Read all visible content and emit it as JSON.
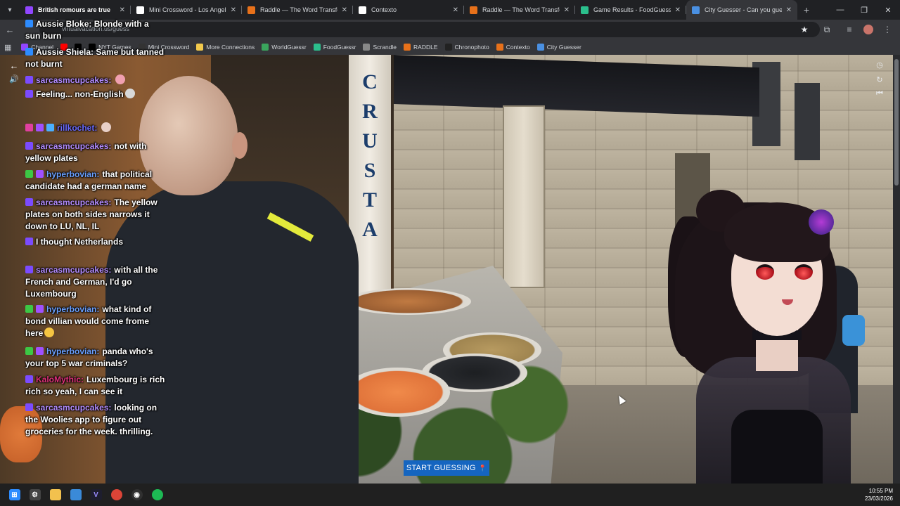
{
  "tabs": [
    {
      "title": "British romours are true",
      "favicon": "twitch-icon",
      "color": "#9146ff",
      "active": false
    },
    {
      "title": "Mini Crossword - Los Angeles T",
      "favicon": "la-times-icon",
      "color": "#ffffff",
      "active": false
    },
    {
      "title": "Raddle — The Word Transform",
      "favicon": "raddle-icon",
      "color": "#e8711a",
      "active": false
    },
    {
      "title": "Contexto",
      "favicon": "document-icon",
      "color": "#ffffff",
      "active": false
    },
    {
      "title": "Raddle — The Word Transform",
      "favicon": "raddle-icon",
      "color": "#e8711a",
      "active": false
    },
    {
      "title": "Game Results - FoodGuessr | F",
      "favicon": "foodguessr-icon",
      "color": "#2bbf8c",
      "active": false
    },
    {
      "title": "City Guesser - Can you gue",
      "favicon": "globe-icon",
      "color": "#4a90e2",
      "active": true
    }
  ],
  "omnibox": {
    "url": "virtualvacation.us/guess"
  },
  "bookmarks": [
    {
      "label": "Channel",
      "icon": "twitch-icon",
      "color": "#9146ff"
    },
    {
      "label": "",
      "icon": "youtube-icon",
      "color": "#ff0000"
    },
    {
      "label": "",
      "icon": "x-icon",
      "color": "#000000"
    },
    {
      "label": "NYT Games",
      "icon": "nyt-icon",
      "color": "#000000"
    },
    {
      "label": "Mini Crossword",
      "icon": "la-times-icon",
      "color": "#333333"
    },
    {
      "label": "More Connections",
      "icon": "grid-icon",
      "color": "#f2c94c"
    },
    {
      "label": "WorldGuessr",
      "icon": "globe-icon",
      "color": "#3aa55d"
    },
    {
      "label": "FoodGuessr",
      "icon": "foodguessr-icon",
      "color": "#2bbf8c"
    },
    {
      "label": "Scrandle",
      "icon": "scrandle-icon",
      "color": "#888888"
    },
    {
      "label": "RADDLE",
      "icon": "raddle-icon",
      "color": "#e8711a"
    },
    {
      "label": "Chronophoto",
      "icon": "camera-icon",
      "color": "#222222"
    },
    {
      "label": "Contexto",
      "icon": "document-icon",
      "color": "#e8711a"
    },
    {
      "label": "City Guesser",
      "icon": "globe-icon",
      "color": "#4a90e2"
    }
  ],
  "chat": [
    {
      "user": "",
      "user_color": "#e0307a",
      "text": "Aussie Bloke: Blonde with a sun burn",
      "badges": [
        "#2d8cff"
      ]
    },
    {
      "user": "",
      "user_color": "#e0307a",
      "text": "Aussie Shiela: Same but tanned not burnt",
      "badges": [
        "#2d8cff"
      ]
    },
    {
      "user": "sarcasmcupcakes:",
      "user_color": "#b38cff",
      "text": "",
      "badges": [
        "#7b4bff"
      ],
      "emote": "#f0a0b0"
    },
    {
      "user": "",
      "user_color": "#e0307a",
      "text": "Feeling... non-English",
      "badges": [
        "#7b4bff"
      ],
      "emote": "#d8d8d8"
    },
    {
      "user": "rillkochet:",
      "user_color": "#6b6bff",
      "text": "",
      "badges": [
        "#e040a0",
        "#a050ff",
        "#4ab0ff"
      ],
      "emote": "#e8d0c8"
    },
    {
      "user": "sarcasmcupcakes:",
      "user_color": "#b38cff",
      "text": "not with yellow plates",
      "badges": [
        "#7b4bff"
      ]
    },
    {
      "user": "hyperbovian:",
      "user_color": "#6aa0ff",
      "text": "that political candidate had a german name",
      "badges": [
        "#3cc845",
        "#a050ff"
      ]
    },
    {
      "user": "sarcasmcupcakes:",
      "user_color": "#b38cff",
      "text": "The yellow plates on both sides narrows it down to LU, NL, IL",
      "badges": [
        "#7b4bff"
      ]
    },
    {
      "user": "",
      "user_color": "#e0307a",
      "text": "I thought Netherlands",
      "badges": [
        "#7b4bff"
      ]
    },
    {
      "user": "sarcasmcupcakes:",
      "user_color": "#b38cff",
      "text": "with all the French and German, I'd go Luxembourg",
      "badges": [
        "#7b4bff"
      ]
    },
    {
      "user": "hyperbovian:",
      "user_color": "#6aa0ff",
      "text": "what kind of bond villian would come frome here",
      "badges": [
        "#3cc845",
        "#a050ff"
      ],
      "emote": "#f5c542"
    },
    {
      "user": "hyperbovian:",
      "user_color": "#6aa0ff",
      "text": "panda who's your top 5 war criminals?",
      "badges": [
        "#3cc845",
        "#a050ff"
      ]
    },
    {
      "user": "KaloMythic:",
      "user_color": "#e0307a",
      "text": "Luxembourg is rich rich so yeah, I can see it",
      "badges": [
        "#7b4bff"
      ]
    },
    {
      "user": "sarcasmcupcakes:",
      "user_color": "#b38cff",
      "text": "looking on the Woolies app to figure out groceries for the week. thrilling.",
      "badges": [
        "#7b4bff"
      ]
    }
  ],
  "game": {
    "sign_text": "CRUSTA",
    "start_button": "START GUESSING",
    "pin_icon": "map-pin-icon"
  },
  "clock": {
    "time": "10:55 PM",
    "date": "23/03/2026"
  }
}
